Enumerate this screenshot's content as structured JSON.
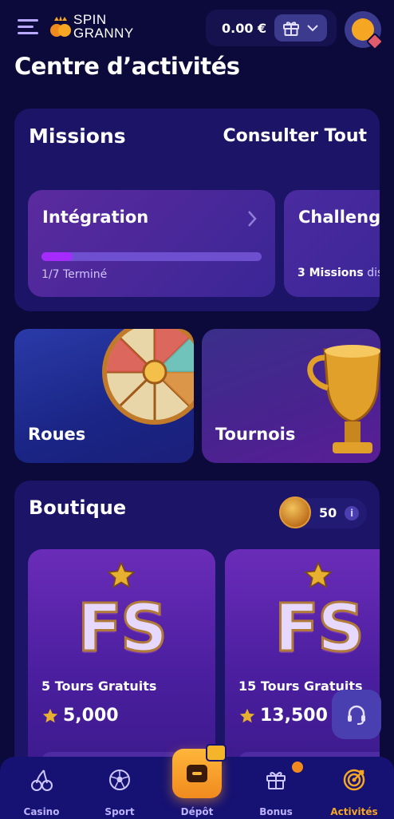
{
  "header": {
    "logo_line1": "SPIN",
    "logo_line2": "GRANNY",
    "balance": "0.00 €"
  },
  "page_title": "Centre d’activités",
  "missions": {
    "title": "Missions",
    "consult_all": "Consulter Tout",
    "items": [
      {
        "name": "Intégration",
        "progress_fraction": 0.143,
        "status": "1/7 Terminé"
      },
      {
        "name": "Challenge",
        "status_count": "3 Missions",
        "status_text": "dis"
      }
    ]
  },
  "promos": [
    {
      "label": "Roues"
    },
    {
      "label": "Tournois"
    }
  ],
  "shop": {
    "title": "Boutique",
    "coins": "50",
    "info": "i",
    "items": [
      {
        "badge": "FS",
        "name": "5 Tours Gratuits",
        "price": "5,000"
      },
      {
        "badge": "FS",
        "name": "15 Tours Gratuits",
        "price": "13,500"
      }
    ]
  },
  "bottom_nav": [
    {
      "label": "Casino"
    },
    {
      "label": "Sport"
    },
    {
      "label": "Dépôt"
    },
    {
      "label": "Bonus"
    },
    {
      "label": "Activités"
    }
  ],
  "colors": {
    "background": "#0c0a3a",
    "card": "#1b1467",
    "accent": "#f5a623",
    "progress": "#a52bff"
  }
}
